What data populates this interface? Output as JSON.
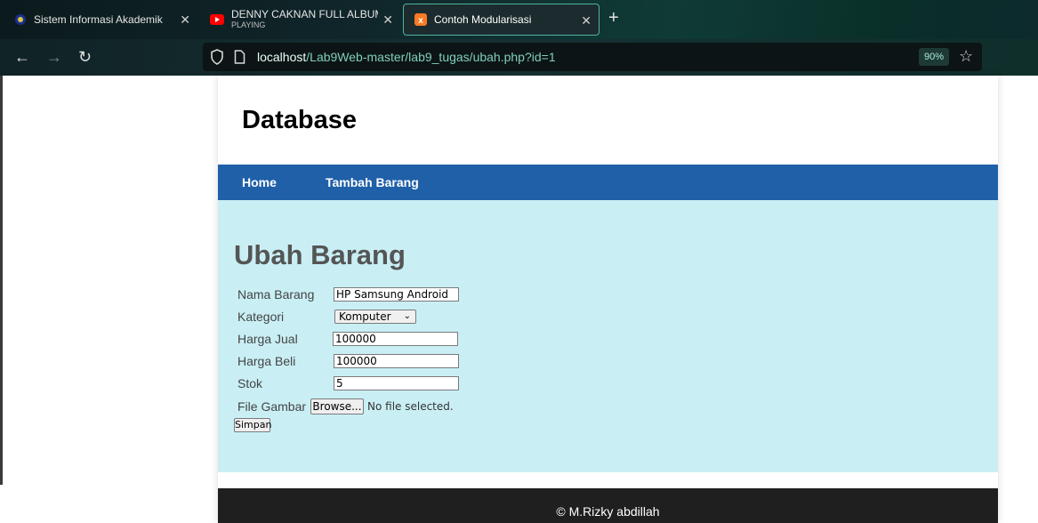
{
  "browser": {
    "tabs": [
      {
        "title": "Sistem Informasi Akademik"
      },
      {
        "title": "DENNY CAKNAN FULL ALBUM",
        "subtitle": "PLAYING"
      },
      {
        "title": "Contoh Modularisasi"
      }
    ],
    "url_host": "localhost",
    "url_path": "/Lab9Web-master/lab9_tugas/ubah.php?id=1",
    "zoom": "90%"
  },
  "site": {
    "title": "Database",
    "nav": [
      "Home",
      "Tambah Barang"
    ]
  },
  "form": {
    "heading": "Ubah Barang",
    "labels": {
      "nama": "Nama Barang",
      "kategori": "Kategori",
      "harga_jual": "Harga Jual",
      "harga_beli": "Harga Beli",
      "stok": "Stok",
      "gambar": "File Gambar"
    },
    "values": {
      "nama": "HP Samsung Android",
      "kategori": "Komputer",
      "harga_jual": "100000",
      "harga_beli": "100000",
      "stok": "5"
    },
    "browse_label": "Browse...",
    "file_status": "No file selected.",
    "submit_label": "Simpan"
  },
  "footer": {
    "text": "© M.Rizky abdillah"
  },
  "colors": {
    "nav_bg": "#2060a8",
    "content_bg": "#c9eff5",
    "footer_bg": "#1f1f1f"
  }
}
